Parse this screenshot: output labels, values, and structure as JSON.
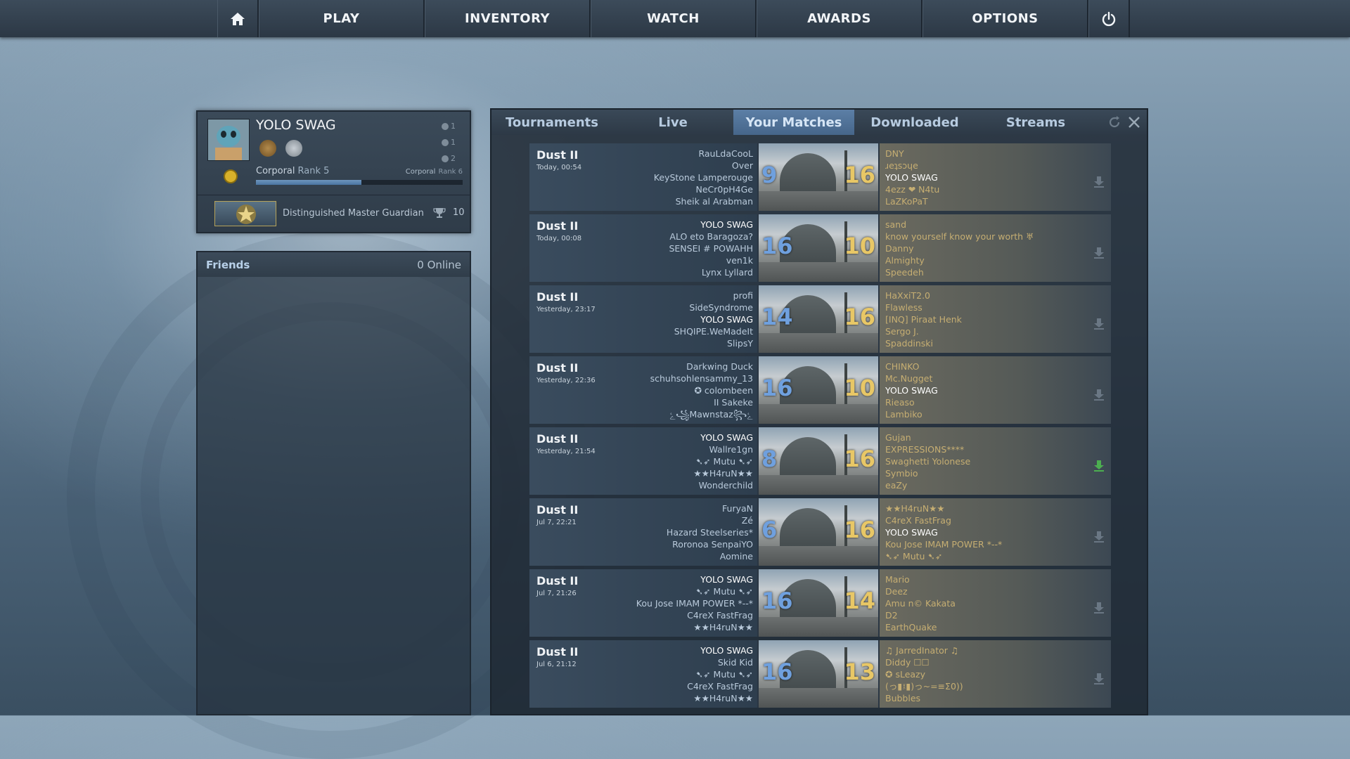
{
  "nav": {
    "items": [
      {
        "label": "PLAY"
      },
      {
        "label": "INVENTORY"
      },
      {
        "label": "WATCH"
      },
      {
        "label": "AWARDS"
      },
      {
        "label": "OPTIONS"
      }
    ],
    "icons": {
      "home": "home-icon",
      "power": "power-icon"
    }
  },
  "profile": {
    "name": "YOLO SWAG",
    "stats": [
      {
        "icon": "smiley-icon",
        "value": "1"
      },
      {
        "icon": "teacher-icon",
        "value": "1"
      },
      {
        "icon": "crown-icon",
        "value": "2"
      }
    ],
    "rank_current_label": "Corporal",
    "rank_current_num": "Rank 5",
    "rank_next_label": "Corporal",
    "rank_next_num": "Rank 6",
    "xp_fraction": 0.51,
    "skill_group": "Distinguished Master Guardian",
    "trophies": "10"
  },
  "friends": {
    "title": "Friends",
    "online": "0 Online"
  },
  "watch": {
    "tabs": [
      {
        "label": "Tournaments",
        "active": false
      },
      {
        "label": "Live",
        "active": false
      },
      {
        "label": "Your Matches",
        "active": true
      },
      {
        "label": "Downloaded",
        "active": false
      },
      {
        "label": "Streams",
        "active": false
      }
    ],
    "matches": [
      {
        "map": "Dust II",
        "date": "Today, 00:54",
        "score_a": "9",
        "score_b": "16",
        "team_a": [
          "RauLdaCooL",
          "Over",
          "KeyStone Lamperouge",
          "NeCr0pH4Ge",
          "Sheik al Arabman"
        ],
        "team_b": [
          "DNY",
          "ɹeʇsɔɥe",
          "YOLO SWAG",
          "4ezz ❤ N4tu",
          "LaZKoPaT"
        ],
        "downloaded": false
      },
      {
        "map": "Dust II",
        "date": "Today, 00:08",
        "score_a": "16",
        "score_b": "10",
        "team_a": [
          "YOLO SWAG",
          "ALO eto Baragoza?",
          "SENSEI # POWAHH",
          "ven1k",
          "Lynx Lyllard"
        ],
        "team_b": [
          "sand",
          "know yourself know your worth ♅",
          "Danny",
          "Almighty",
          "Speedeh"
        ],
        "downloaded": false
      },
      {
        "map": "Dust II",
        "date": "Yesterday, 23:17",
        "score_a": "14",
        "score_b": "16",
        "team_a": [
          "profi",
          "SideSyndrome",
          "YOLO SWAG",
          "SHQIPE.WeMadeIt",
          "SlipsY"
        ],
        "team_b": [
          "HaXxiT2.0",
          "Flawless",
          "[INQ] Piraat Henk",
          "Sergo J.",
          "Spaddinski"
        ],
        "downloaded": false
      },
      {
        "map": "Dust II",
        "date": "Yesterday, 22:36",
        "score_a": "16",
        "score_b": "10",
        "team_a": [
          "Darkwing Duck",
          "schuhsohlensammy_13",
          "✪ colombeen",
          "II Sakeke",
          "ﮰ꧁Mawnstaz꧂ﮰ"
        ],
        "team_b": [
          "CHINKO",
          "Mc.Nugget",
          "YOLO SWAG",
          "Rieaso",
          "Lambiko"
        ],
        "downloaded": false
      },
      {
        "map": "Dust II",
        "date": "Yesterday, 21:54",
        "score_a": "8",
        "score_b": "16",
        "team_a": [
          "YOLO SWAG",
          "Wallre1gn",
          "➷➶ Mutu ➷➶",
          "★★H4ruN★★",
          "Wonderchild"
        ],
        "team_b": [
          "Gujan",
          "EXPRESSIONS****",
          "Swaghetti Yolonese",
          "Symbio",
          "eaZy"
        ],
        "downloaded": true
      },
      {
        "map": "Dust II",
        "date": "Jul 7, 22:21",
        "score_a": "6",
        "score_b": "16",
        "team_a": [
          "FuryaN",
          "Zé",
          "Hazard Steelseries*",
          "Roronoa SenpaiYO",
          "Aomine"
        ],
        "team_b": [
          "★★H4ruN★★",
          "C4reX FastFrag",
          "YOLO SWAG",
          "Kou Jose IMAM POWER *--*",
          "➷➶ Mutu ➷➶"
        ],
        "downloaded": false
      },
      {
        "map": "Dust II",
        "date": "Jul 7, 21:26",
        "score_a": "16",
        "score_b": "14",
        "team_a": [
          "YOLO SWAG",
          "➷➶ Mutu ➷➶",
          "Kou Jose IMAM POWER *--*",
          "C4reX FastFrag",
          "★★H4ruN★★"
        ],
        "team_b": [
          "Mario",
          "Deez",
          "Amu n© Kakata",
          "D2",
          "EarthQuake"
        ],
        "downloaded": false
      },
      {
        "map": "Dust II",
        "date": "Jul 6, 21:12",
        "score_a": "16",
        "score_b": "13",
        "team_a": [
          "YOLO SWAG",
          "Skid Kid",
          "➷➶ Mutu ➷➶",
          "C4reX FastFrag",
          "★★H4ruN★★"
        ],
        "team_b": [
          "♫ JarredInator ♫",
          "Diddy ☐☐",
          "✪ sLeazy",
          "(っ▮፤▮)っ~=≡Σ0))",
          "Bubbles"
        ],
        "downloaded": false
      }
    ],
    "highlight_player": "YOLO SWAG"
  },
  "colors": {
    "team_ct": "#6fa0de",
    "team_t": "#e8c766",
    "download_active": "#4caf50",
    "download_inactive": "#6a7784"
  }
}
